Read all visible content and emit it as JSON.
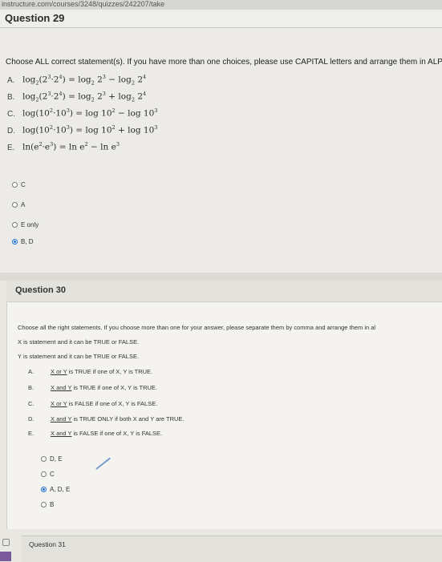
{
  "browser": {
    "url": "instructure.com/courses/3248/quizzes/242207/take"
  },
  "q29": {
    "title": "Question 29",
    "prompt": "Choose ALL correct statement(s). If you have more than one choices, please use CAPITAL letters and arrange them in ALPHAB",
    "statements": [
      {
        "letter": "A.",
        "lhs_fn": "log",
        "lhs_sub": "2",
        "lhs_args": [
          "2",
          "3",
          "2",
          "4"
        ],
        "op": "−",
        "rhs": "log₂ 2³ − log₂ 2⁴"
      },
      {
        "letter": "B.",
        "op": "+"
      },
      {
        "letter": "C.",
        "op": "−"
      },
      {
        "letter": "D.",
        "op": "+"
      },
      {
        "letter": "E.",
        "op": "−"
      }
    ],
    "choices": [
      {
        "label": "C",
        "selected": false
      },
      {
        "label": "A",
        "selected": false
      },
      {
        "label": "E only",
        "selected": false
      },
      {
        "label": "B, D",
        "selected": true
      }
    ]
  },
  "q30": {
    "title": "Question 30",
    "prompt": "Choose all the right statements. If you choose more than one for your answer, please separate them by comma and arrange them in al",
    "line1": "X is statement and it can be TRUE or FALSE.",
    "line2": "Y is statement and it can be TRUE or FALSE.",
    "items": [
      {
        "letter": "A.",
        "u": "X or Y",
        "rest": " is TRUE if one of X, Y is TRUE."
      },
      {
        "letter": "B.",
        "u": "X and Y",
        "rest": " is TRUE if one of X, Y is TRUE."
      },
      {
        "letter": "C.",
        "u": "X or Y",
        "rest": " is FALSE if one of X, Y is FALSE."
      },
      {
        "letter": "D.",
        "u": "X and Y",
        "rest": " is TRUE ONLY if both X and Y are TRUE."
      },
      {
        "letter": "E.",
        "u": "X and Y",
        "rest": " is FALSE if one of X, Y is FALSE."
      }
    ],
    "choices": [
      {
        "label": "D, E",
        "selected": false
      },
      {
        "label": "C",
        "selected": false
      },
      {
        "label": "A, D, E",
        "selected": true
      },
      {
        "label": "B",
        "selected": false
      }
    ]
  },
  "q31": {
    "title": "Question 31"
  },
  "colors": {
    "accent": "#1e6fd1",
    "page_bg": "#ecebe7"
  }
}
